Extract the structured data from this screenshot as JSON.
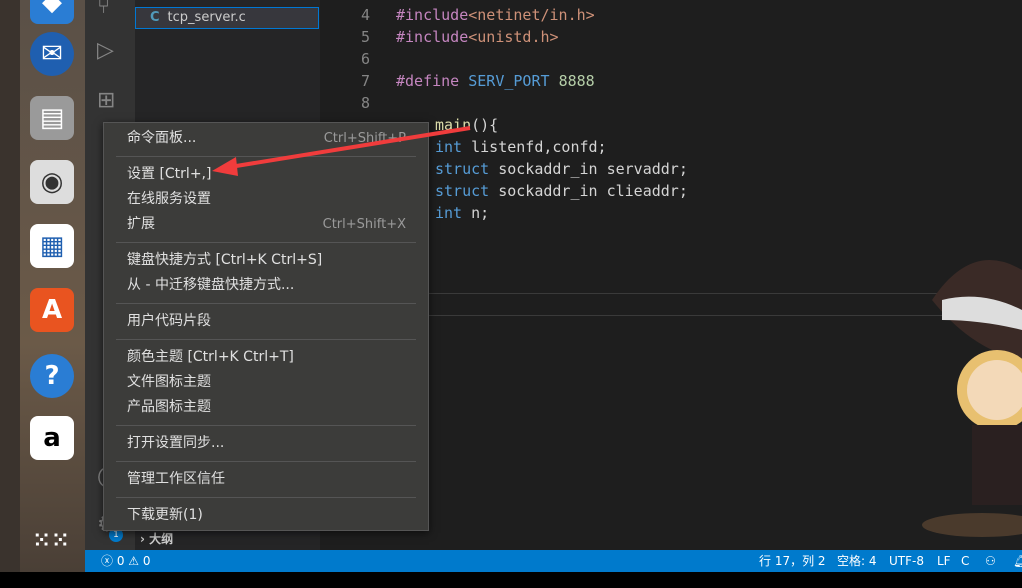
{
  "explorer": {
    "active_file": "tcp_server.c",
    "file_icon": "C",
    "outline": "大纲"
  },
  "editor": {
    "lines": [
      {
        "n": "4",
        "t": [
          [
            "pp",
            "#include"
          ],
          [
            "str",
            "<netinet/in.h>"
          ]
        ]
      },
      {
        "n": "5",
        "t": [
          [
            "pp",
            "#include"
          ],
          [
            "str",
            "<unistd.h>"
          ]
        ]
      },
      {
        "n": "6",
        "t": []
      },
      {
        "n": "7",
        "t": [
          [
            "pp",
            "#define "
          ],
          [
            "mac",
            "SERV_PORT"
          ],
          [
            "",
            " "
          ],
          [
            "num",
            "8888"
          ]
        ]
      },
      {
        "n": "8",
        "t": []
      },
      {
        "n": "",
        "t": [
          [
            "fn",
            "main"
          ],
          [
            "",
            "(){"
          ]
        ]
      },
      {
        "n": "",
        "t": [
          [
            "kw",
            "int"
          ],
          [
            "",
            " listenfd,confd;"
          ]
        ]
      },
      {
        "n": "",
        "t": [
          [
            "kw",
            "struct"
          ],
          [
            "",
            " sockaddr_in servaddr;"
          ]
        ]
      },
      {
        "n": "",
        "t": [
          [
            "kw",
            "struct"
          ],
          [
            "",
            " sockaddr_in clieaddr;"
          ]
        ]
      },
      {
        "n": "",
        "t": [
          [
            "kw",
            "int"
          ],
          [
            "",
            " n;"
          ]
        ]
      }
    ]
  },
  "menu": {
    "items": [
      {
        "label": "命令面板...",
        "shortcut": "Ctrl+Shift+P"
      },
      {
        "label": "设置 [Ctrl+,]",
        "shortcut": ""
      },
      {
        "label": "在线服务设置",
        "shortcut": ""
      },
      {
        "label": "扩展",
        "shortcut": "Ctrl+Shift+X"
      },
      {
        "label": "键盘快捷方式 [Ctrl+K Ctrl+S]",
        "shortcut": ""
      },
      {
        "label": "从 - 中迁移键盘快捷方式...",
        "shortcut": ""
      },
      {
        "label": "用户代码片段",
        "shortcut": ""
      },
      {
        "label": "颜色主题 [Ctrl+K Ctrl+T]",
        "shortcut": ""
      },
      {
        "label": "文件图标主题",
        "shortcut": ""
      },
      {
        "label": "产品图标主题",
        "shortcut": ""
      },
      {
        "label": "打开设置同步...",
        "shortcut": ""
      },
      {
        "label": "管理工作区信任",
        "shortcut": ""
      },
      {
        "label": "下载更新(1)",
        "shortcut": ""
      }
    ]
  },
  "activity": {
    "badge": "1"
  },
  "status": {
    "errors": "0",
    "warnings": "0",
    "position": "行 17，列 2",
    "spaces": "空格: 4",
    "encoding": "UTF-8",
    "eol": "LF",
    "language": "C"
  },
  "colors": {
    "accent": "#007acc",
    "arrow": "#f03c3c"
  }
}
